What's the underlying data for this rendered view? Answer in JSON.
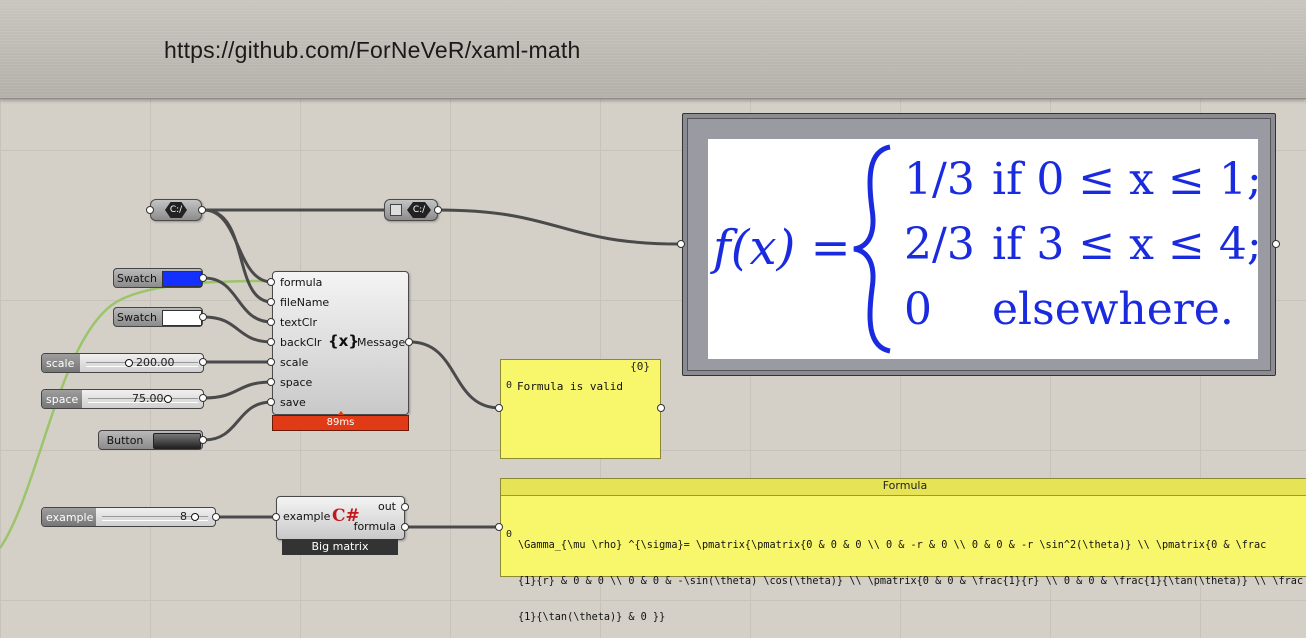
{
  "header": {
    "url": "https://github.com/ForNeVeR/xaml-math"
  },
  "relays": {
    "left_icon": "C:/",
    "right_icon": "C:/"
  },
  "swatches": [
    {
      "label": "Swatch",
      "color": "#1330ff"
    },
    {
      "label": "Swatch",
      "color": "#ffffff"
    }
  ],
  "sliders": {
    "scale": {
      "name": "scale",
      "value": "200.00"
    },
    "space": {
      "name": "space",
      "value": "75.00"
    },
    "example": {
      "name": "example",
      "value": "8"
    }
  },
  "button": {
    "label": "Button"
  },
  "main_component": {
    "inputs": [
      "formula",
      "fileName",
      "textClr",
      "backClr",
      "scale",
      "space",
      "save"
    ],
    "icon": "{x}",
    "output": "Message",
    "timing": "89ms",
    "timing_color": "#e03a16"
  },
  "message_panel": {
    "title": "{0}",
    "index": "0",
    "text": "Formula is valid"
  },
  "csharp_component": {
    "input": "example",
    "outputs": [
      "out",
      "formula"
    ],
    "icon": "C#",
    "caption": "Big matrix"
  },
  "formula_panel": {
    "title": "Formula",
    "index": "0",
    "lines": [
      "\\Gamma_{\\mu \\rho} ^{\\sigma}= \\pmatrix{\\pmatrix{0 & 0 & 0 \\\\ 0 & -r & 0 \\\\ 0 & 0 & -r \\sin^2(\\theta)} \\\\ \\pmatrix{0 & \\frac",
      "{1}{r} & 0 & 0 \\\\ 0 & 0 & -\\sin(\\theta) \\cos(\\theta)} \\\\ \\pmatrix{0 & 0 & \\frac{1}{r} \\\\ 0 & 0 & \\frac{1}{\\tan(\\theta)} \\\\ \\frac",
      "{1}{\\tan(\\theta)} & 0 }}"
    ]
  },
  "rendered_formula": {
    "lhs": "f(x) =",
    "rows": [
      {
        "value": "1/3",
        "cond": "if 0 ≤ x ≤ 1;"
      },
      {
        "value": "2/3",
        "cond": "if 3 ≤ x ≤ 4;"
      },
      {
        "value": "0",
        "cond": "elsewhere."
      }
    ],
    "color": "#1a2bdf"
  }
}
